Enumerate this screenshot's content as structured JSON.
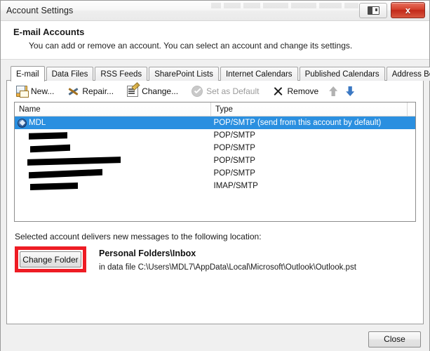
{
  "window": {
    "title": "Account Settings",
    "restore_button_icon": "restore-window-icon",
    "close_button_label": "x"
  },
  "header": {
    "title": "E-mail Accounts",
    "subtitle": "You can add or remove an account. You can select an account and change its settings."
  },
  "tabs": [
    {
      "label": "E-mail",
      "active": true
    },
    {
      "label": "Data Files",
      "active": false
    },
    {
      "label": "RSS Feeds",
      "active": false
    },
    {
      "label": "SharePoint Lists",
      "active": false
    },
    {
      "label": "Internet Calendars",
      "active": false
    },
    {
      "label": "Published Calendars",
      "active": false
    },
    {
      "label": "Address Books",
      "active": false
    }
  ],
  "toolbar": {
    "new_label": "New...",
    "repair_label": "Repair...",
    "change_label": "Change...",
    "set_default_label": "Set as Default",
    "remove_label": "Remove",
    "move_up_icon": "arrow-up-icon",
    "move_down_icon": "arrow-down-icon"
  },
  "accounts_list": {
    "columns": [
      "Name",
      "Type"
    ],
    "rows": [
      {
        "name": "MDL",
        "type": "POP/SMTP (send from this account by default)",
        "selected": true,
        "redacted": false,
        "redact_width": 0
      },
      {
        "name": "",
        "type": "POP/SMTP",
        "selected": false,
        "redacted": true,
        "redact_width": 55
      },
      {
        "name": "",
        "type": "POP/SMTP",
        "selected": false,
        "redacted": true,
        "redact_width": 57
      },
      {
        "name": "",
        "type": "POP/SMTP",
        "selected": false,
        "redacted": true,
        "redact_width": 133
      },
      {
        "name": "",
        "type": "POP/SMTP",
        "selected": false,
        "redacted": true,
        "redact_width": 105
      },
      {
        "name": "",
        "type": "IMAP/SMTP",
        "selected": false,
        "redacted": true,
        "redact_width": 68
      }
    ]
  },
  "delivery": {
    "label": "Selected account delivers new messages to the following location:",
    "change_folder_label": "Change Folder",
    "folder_name": "Personal Folders\\Inbox",
    "folder_path": "in data file C:\\Users\\MDL7\\AppData\\Local\\Microsoft\\Outlook\\Outlook.pst",
    "highlight_color": "#ee1c24"
  },
  "footer": {
    "close_label": "Close"
  },
  "colors": {
    "selection": "#2a8fe0",
    "close_button": "#c2291a",
    "arrow_enabled": "#3b78c3",
    "arrow_disabled": "#b2b2b2",
    "annotation": "#ee1c24"
  }
}
